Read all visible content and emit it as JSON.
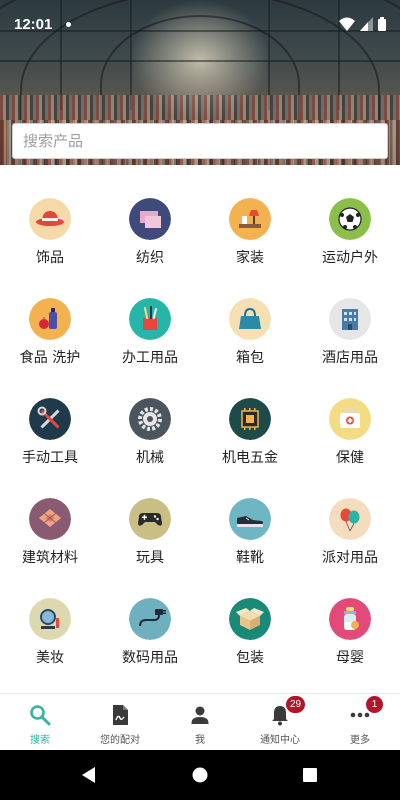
{
  "status_bar": {
    "time": "12:01"
  },
  "search": {
    "placeholder": "搜索产品"
  },
  "categories": [
    {
      "label": "饰品",
      "icon": "hat-icon",
      "bg": "#f6d9a9"
    },
    {
      "label": "纺织",
      "icon": "fabric-icon",
      "bg": "#3d4a7a"
    },
    {
      "label": "家装",
      "icon": "home-decor-icon",
      "bg": "#f3b14f"
    },
    {
      "label": "运动户外",
      "icon": "soccer-ball-icon",
      "bg": "#8cbf4a"
    },
    {
      "label": "食品 洗护",
      "icon": "groceries-icon",
      "bg": "#f3b14f"
    },
    {
      "label": "办工用品",
      "icon": "pen-holder-icon",
      "bg": "#26b5a6"
    },
    {
      "label": "箱包",
      "icon": "handbag-icon",
      "bg": "#f6e0b3"
    },
    {
      "label": "酒店用品",
      "icon": "hotel-building-icon",
      "bg": "#e6e6e6"
    },
    {
      "label": "手动工具",
      "icon": "tools-icon",
      "bg": "#1f3a4a"
    },
    {
      "label": "机械",
      "icon": "gear-icon",
      "bg": "#4b555d"
    },
    {
      "label": "机电五金",
      "icon": "chip-icon",
      "bg": "#1f4a4a"
    },
    {
      "label": "保健",
      "icon": "first-aid-kit-icon",
      "bg": "#f3dc83"
    },
    {
      "label": "建筑材料",
      "icon": "building-materials-icon",
      "bg": "#8a5a72"
    },
    {
      "label": "玩具",
      "icon": "gamepad-icon",
      "bg": "#c9be84"
    },
    {
      "label": "鞋靴",
      "icon": "shoe-icon",
      "bg": "#6fb6c4"
    },
    {
      "label": "派对用品",
      "icon": "balloons-icon",
      "bg": "#f6dcbf"
    },
    {
      "label": "美妆",
      "icon": "mirror-icon",
      "bg": "#ddd8b0"
    },
    {
      "label": "数码用品",
      "icon": "plug-icon",
      "bg": "#6fb0c0"
    },
    {
      "label": "包装",
      "icon": "box-icon",
      "bg": "#1a8a78"
    },
    {
      "label": "母婴",
      "icon": "baby-bottle-icon",
      "bg": "#e34a7a"
    }
  ],
  "bottom_nav": {
    "items": [
      {
        "label": "搜索",
        "icon": "search-icon",
        "active": true
      },
      {
        "label": "您的配对",
        "icon": "document-icon"
      },
      {
        "label": "我",
        "icon": "person-icon"
      },
      {
        "label": "通知中心",
        "icon": "bell-icon",
        "badge": "29"
      },
      {
        "label": "更多",
        "icon": "more-dots-icon",
        "badge": "1"
      }
    ]
  },
  "colors": {
    "accent": "#35b3a3",
    "badge": "#b3142a"
  }
}
